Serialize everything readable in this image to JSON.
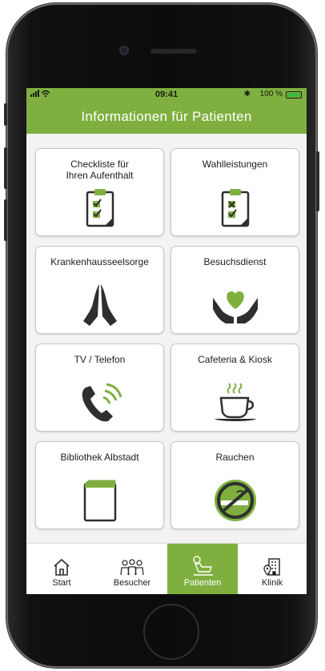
{
  "status_bar": {
    "signal": "…•• ◉",
    "time": "09:41",
    "bluetooth": "✱",
    "battery_text": "100 %"
  },
  "header": {
    "title": "Informationen für Patienten"
  },
  "tiles": [
    {
      "label": "Checkliste für\nIhren Aufenthalt",
      "icon": "clipboard-checklist-icon"
    },
    {
      "label": "Wahlleistungen",
      "icon": "clipboard-options-icon"
    },
    {
      "label": "Krankenhausseelsorge",
      "icon": "praying-hands-icon"
    },
    {
      "label": "Besuchsdienst",
      "icon": "heart-in-hands-icon"
    },
    {
      "label": "TV / Telefon",
      "icon": "phone-ringing-icon"
    },
    {
      "label": "Cafeteria & Kiosk",
      "icon": "coffee-cup-icon"
    },
    {
      "label": "Bibliothek Albstadt",
      "icon": "book-icon"
    },
    {
      "label": "Rauchen",
      "icon": "no-smoking-icon"
    }
  ],
  "tabbar": {
    "items": [
      {
        "label": "Start",
        "icon": "home-icon"
      },
      {
        "label": "Besucher",
        "icon": "visitors-icon"
      },
      {
        "label": "Patienten",
        "icon": "patient-icon",
        "active": true
      },
      {
        "label": "Klinik",
        "icon": "hospital-icon"
      }
    ]
  },
  "colors": {
    "accent": "#7fb03f",
    "icon_dark": "#2f2f2f",
    "icon_green": "#7fb03f"
  }
}
